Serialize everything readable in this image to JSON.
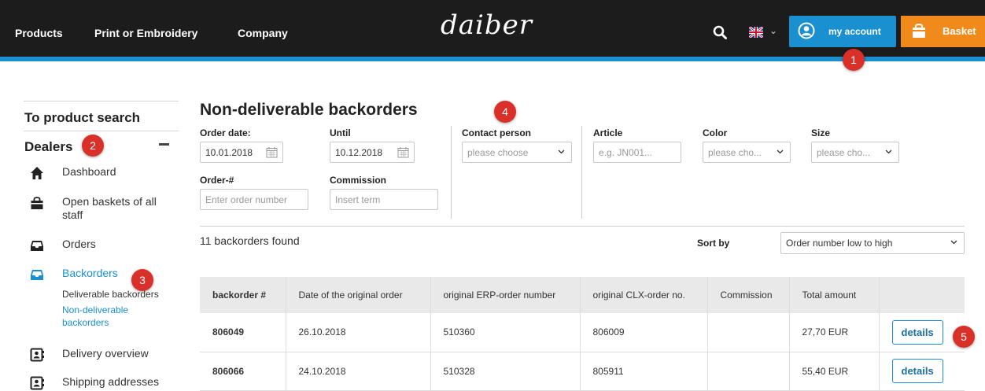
{
  "header": {
    "nav": [
      "Products",
      "Print or Embroidery",
      "Company"
    ],
    "logo": "daiber",
    "account_label": "my account",
    "basket_label": "Basket"
  },
  "markers": [
    "1",
    "2",
    "3",
    "4",
    "5"
  ],
  "sidebar": {
    "product_search": "To product search",
    "dealers": "Dealers",
    "items": [
      {
        "label": "Dashboard",
        "icon": "home-icon"
      },
      {
        "label": "Open baskets of all staff",
        "icon": "basket-icon"
      },
      {
        "label": "Orders",
        "icon": "inbox-icon"
      },
      {
        "label": "Backorders",
        "icon": "inbox-icon"
      },
      {
        "label": "Delivery overview",
        "icon": "contact-card-icon"
      },
      {
        "label": "Shipping addresses",
        "icon": "contact-card-icon"
      }
    ],
    "sub_items": [
      "Deliverable backorders",
      "Non-deliverable backorders"
    ]
  },
  "main": {
    "title": "Non-deliverable backorders",
    "filters": {
      "order_date_label": "Order date:",
      "order_date_value": "10.01.2018",
      "until_label": "Until",
      "until_value": "10.12.2018",
      "order_no_label": "Order-#",
      "order_no_placeholder": "Enter order number",
      "commission_label": "Commission",
      "commission_placeholder": "Insert term",
      "contact_label": "Contact person",
      "contact_value": "please choose",
      "article_label": "Article",
      "article_placeholder": "e.g. JN001...",
      "color_label": "Color",
      "color_value": "please cho...",
      "size_label": "Size",
      "size_value": "please cho..."
    },
    "found_text": "11 backorders found",
    "sort_label": "Sort by",
    "sort_value": "Order number low to high",
    "table": {
      "headers": [
        "backorder #",
        "Date of the original order",
        "original ERP-order number",
        "original CLX-order no.",
        "Commission",
        "Total amount",
        ""
      ],
      "rows": [
        [
          "806049",
          "26.10.2018",
          "510360",
          "806009",
          "",
          "27,70 EUR",
          "details"
        ],
        [
          "806066",
          "24.10.2018",
          "510328",
          "805911",
          "",
          "55,40 EUR",
          "details"
        ]
      ]
    }
  },
  "colors": {
    "accent_blue": "#1a90d0",
    "basket_orange": "#f08a1b",
    "marker_red": "#d9302a",
    "topbar": "#1c1c1c"
  }
}
